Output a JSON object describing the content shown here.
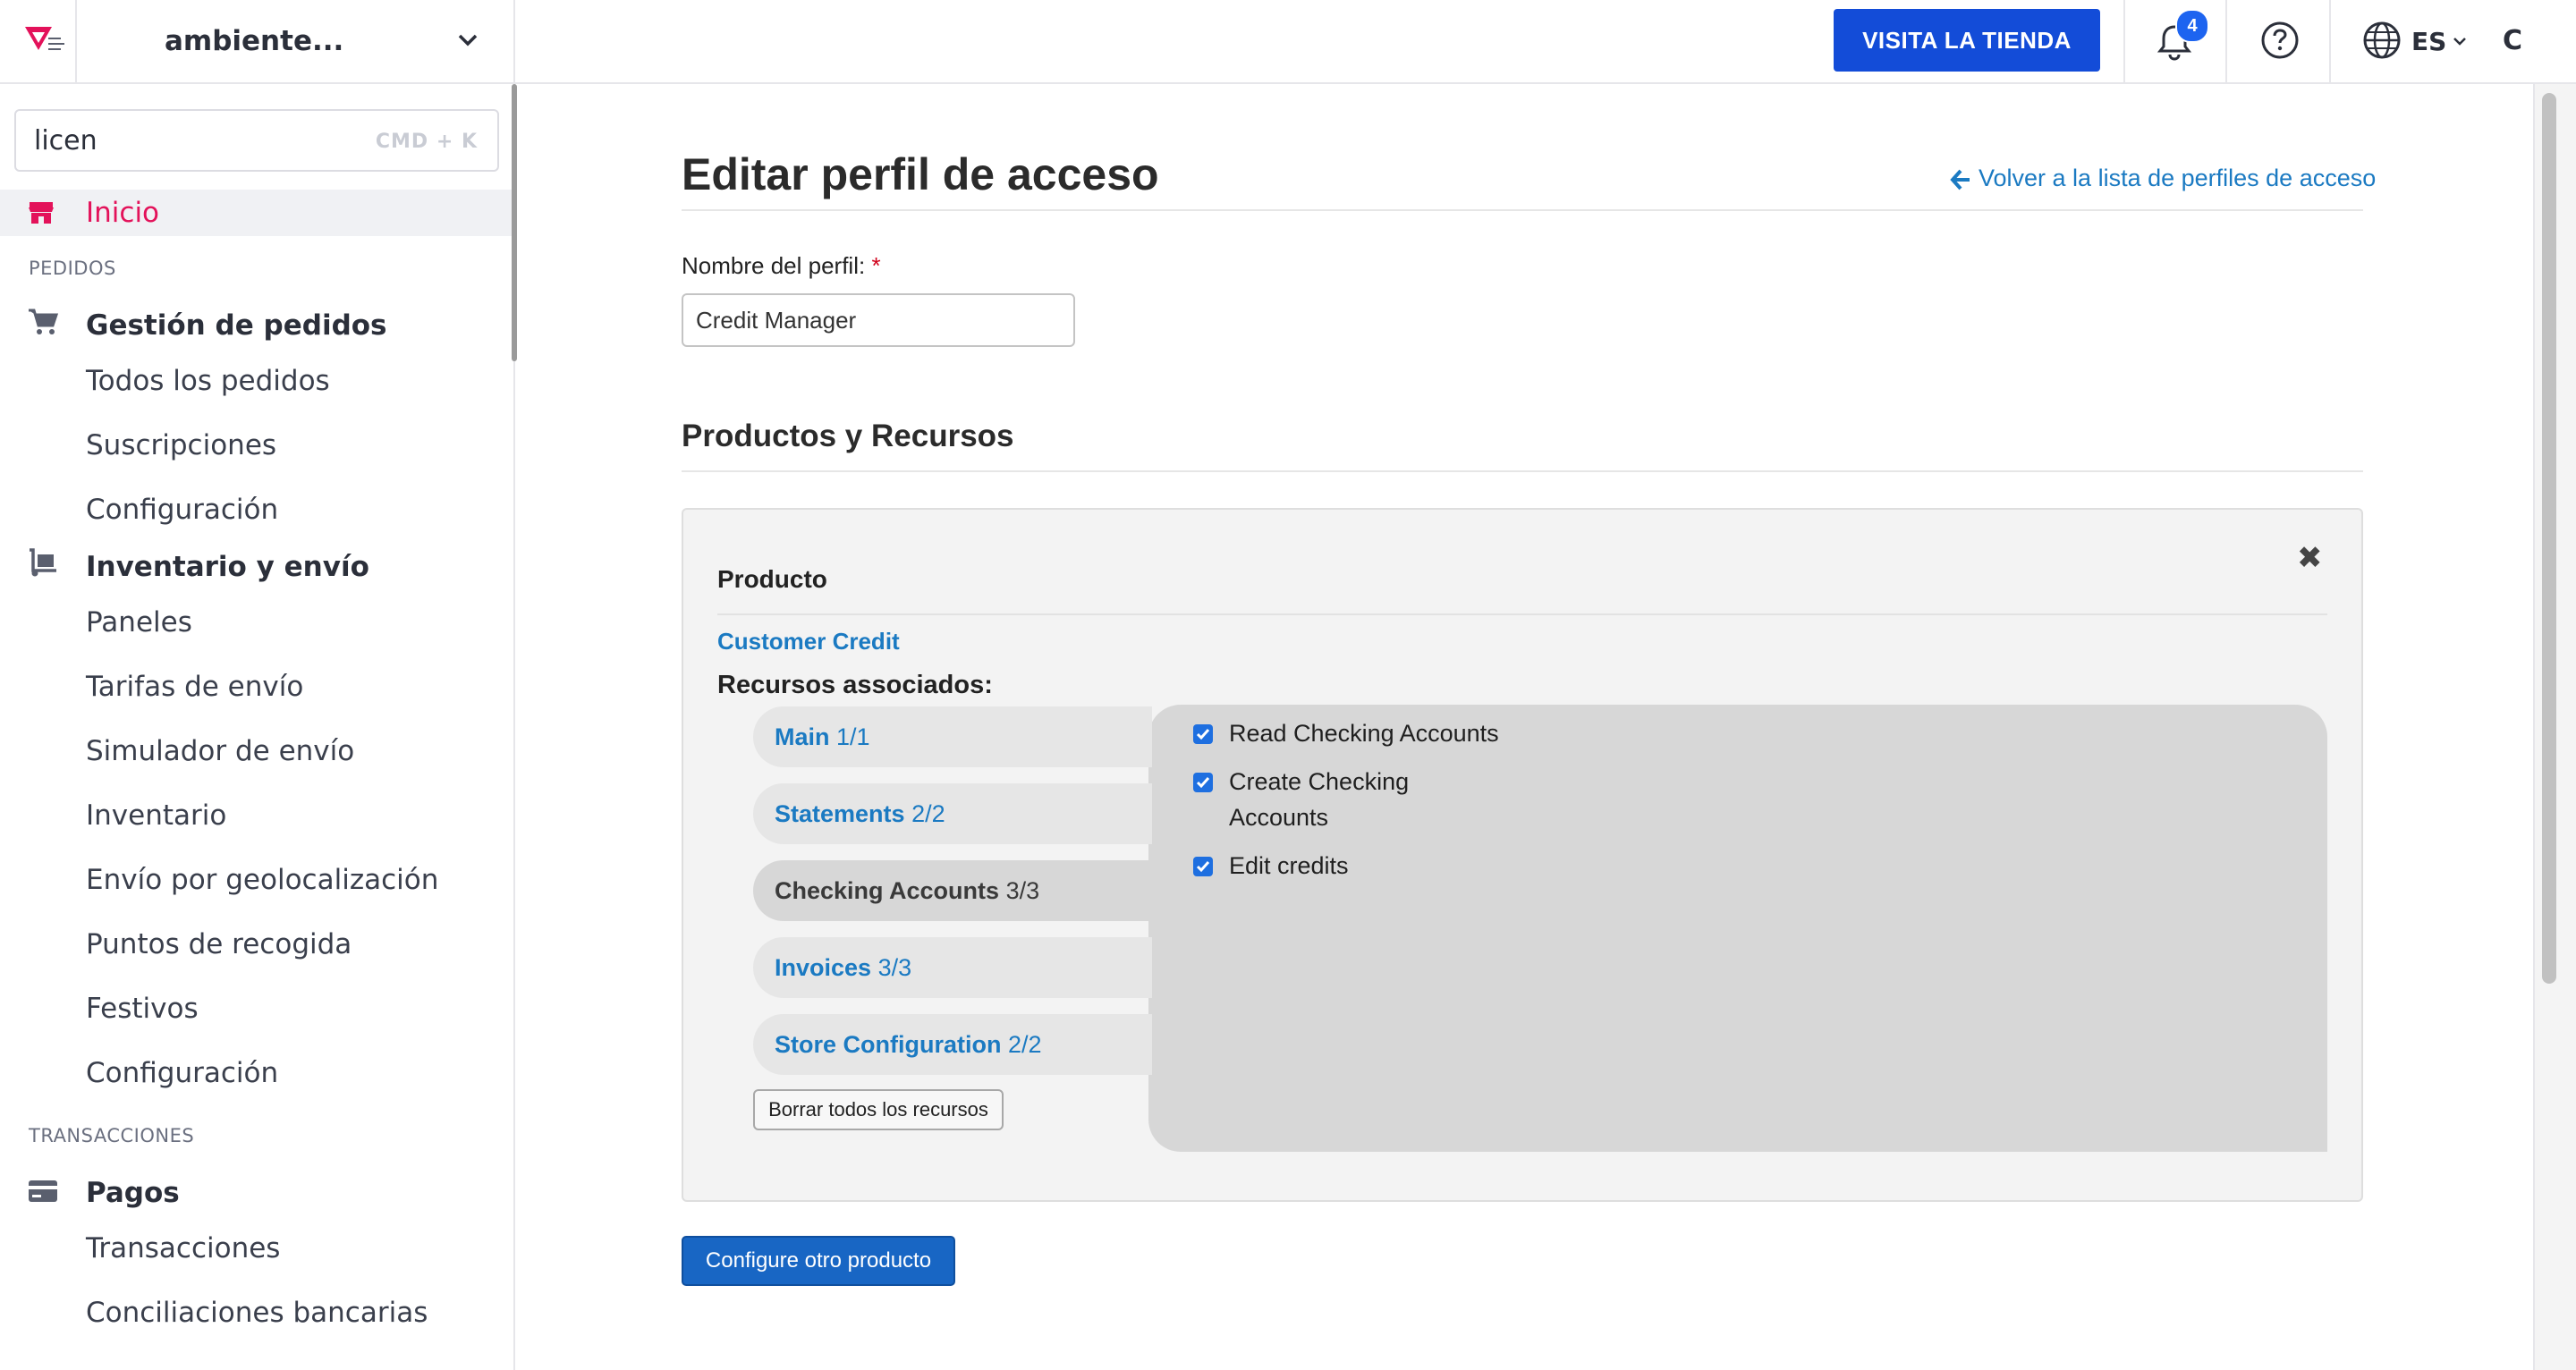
{
  "topbar": {
    "account_name": "ambiente...",
    "visit_store_label": "VISITA LA TIENDA",
    "notifications_count": "4",
    "language": "ES",
    "user_initial": "C"
  },
  "sidebar": {
    "search": {
      "value": "licen",
      "shortcut": "CMD + K"
    },
    "home": "Inicio",
    "sections": [
      {
        "label": "PEDIDOS"
      },
      {
        "label": "TRANSACCIONES"
      }
    ],
    "groups": [
      {
        "label": "Gestión de pedidos",
        "icon": "cart-icon",
        "items": [
          "Todos los pedidos",
          "Suscripciones",
          "Configuración"
        ]
      },
      {
        "label": "Inventario y envío",
        "icon": "dolly-icon",
        "items": [
          "Paneles",
          "Tarifas de envío",
          "Simulador de envío",
          "Inventario",
          "Envío por geolocalización",
          "Puntos de recogida",
          "Festivos",
          "Configuración"
        ]
      },
      {
        "label": "Pagos",
        "icon": "credit-card-icon",
        "items": [
          "Transacciones",
          "Conciliaciones bancarias"
        ]
      }
    ]
  },
  "main": {
    "title": "Editar perfil de acceso",
    "back_link": "Volver a la lista de perfiles de acceso",
    "profile_name_label": "Nombre del perfil:",
    "required_mark": "*",
    "profile_name_value": "Credit Manager",
    "section_title": "Productos y Recursos",
    "product_header": "Producto",
    "close_glyph": "✖",
    "product_name": "Customer Credit",
    "resources_label": "Recursos associados:",
    "resource_tabs": [
      {
        "name": "Main",
        "count": "1/1",
        "active": false
      },
      {
        "name": "Statements",
        "count": "2/2",
        "active": false
      },
      {
        "name": "Checking Accounts",
        "count": "3/3",
        "active": true
      },
      {
        "name": "Invoices",
        "count": "3/3",
        "active": false
      },
      {
        "name": "Store Configuration",
        "count": "2/2",
        "active": false
      }
    ],
    "permissions": [
      {
        "line1": "Read Checking Accounts",
        "line2": "",
        "checked": true
      },
      {
        "line1": "Create Checking",
        "line2": "Accounts",
        "checked": true
      },
      {
        "line1": "Edit credits",
        "line2": "",
        "checked": true
      }
    ],
    "clear_button": "Borrar todos los recursos",
    "configure_button": "Configure otro producto"
  },
  "colors": {
    "brand_pink": "#e3125a",
    "primary_blue": "#134cd8",
    "link_blue": "#1b7ac2",
    "checkbox_blue": "#1e6fe0"
  }
}
